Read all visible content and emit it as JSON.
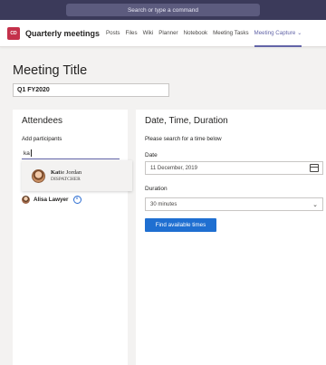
{
  "topbar": {
    "search_placeholder": "Search or type a command"
  },
  "header": {
    "team_initials": "CD",
    "team_name": "Quarterly meetings",
    "tabs": [
      {
        "label": "Posts",
        "active": false
      },
      {
        "label": "Files",
        "active": false
      },
      {
        "label": "Wiki",
        "active": false
      },
      {
        "label": "Planner",
        "active": false
      },
      {
        "label": "Notebook",
        "active": false
      },
      {
        "label": "Meeting Tasks",
        "active": false
      },
      {
        "label": "Meeting Capture",
        "active": true
      }
    ]
  },
  "meeting": {
    "title_label": "Meeting Title",
    "title_value": "Q1 FY2020"
  },
  "attendees": {
    "heading": "Attendees",
    "add_label": "Add participants",
    "search_value": "ka",
    "suggestion": {
      "name_match": "Kat",
      "name_rest": "ie Jordan",
      "role": "DISPATCHER"
    },
    "list": [
      {
        "name": "Alisa Lawyer",
        "remove_icon": "close-circle-icon"
      }
    ]
  },
  "schedule": {
    "heading": "Date, Time, Duration",
    "help_text": "Please search for a time below",
    "date_label": "Date",
    "date_value": "11 December, 2019",
    "duration_label": "Duration",
    "duration_value": "30 minutes",
    "find_button": "Find available times"
  },
  "colors": {
    "accent": "#6264a7",
    "primary_button": "#1f6fd1",
    "team_avatar": "#c4314b",
    "topbar": "#3b3a5a"
  }
}
